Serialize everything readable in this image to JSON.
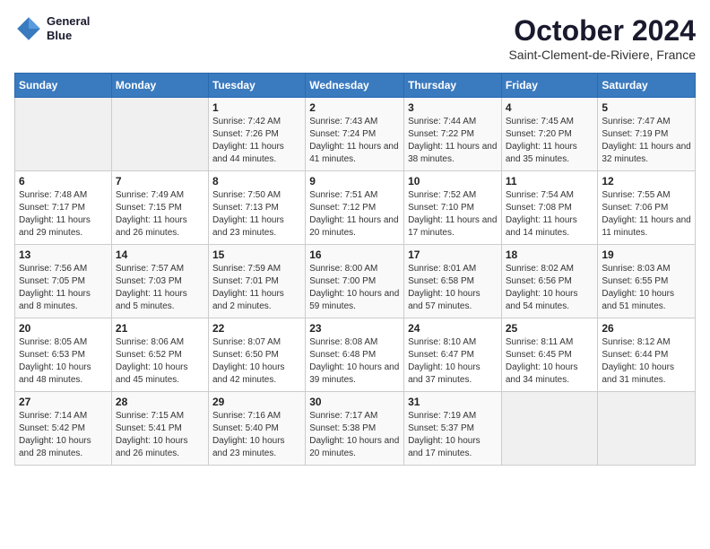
{
  "header": {
    "logo_line1": "General",
    "logo_line2": "Blue",
    "month": "October 2024",
    "location": "Saint-Clement-de-Riviere, France"
  },
  "weekdays": [
    "Sunday",
    "Monday",
    "Tuesday",
    "Wednesday",
    "Thursday",
    "Friday",
    "Saturday"
  ],
  "weeks": [
    [
      {
        "day": "",
        "detail": ""
      },
      {
        "day": "",
        "detail": ""
      },
      {
        "day": "1",
        "detail": "Sunrise: 7:42 AM\nSunset: 7:26 PM\nDaylight: 11 hours and 44 minutes."
      },
      {
        "day": "2",
        "detail": "Sunrise: 7:43 AM\nSunset: 7:24 PM\nDaylight: 11 hours and 41 minutes."
      },
      {
        "day": "3",
        "detail": "Sunrise: 7:44 AM\nSunset: 7:22 PM\nDaylight: 11 hours and 38 minutes."
      },
      {
        "day": "4",
        "detail": "Sunrise: 7:45 AM\nSunset: 7:20 PM\nDaylight: 11 hours and 35 minutes."
      },
      {
        "day": "5",
        "detail": "Sunrise: 7:47 AM\nSunset: 7:19 PM\nDaylight: 11 hours and 32 minutes."
      }
    ],
    [
      {
        "day": "6",
        "detail": "Sunrise: 7:48 AM\nSunset: 7:17 PM\nDaylight: 11 hours and 29 minutes."
      },
      {
        "day": "7",
        "detail": "Sunrise: 7:49 AM\nSunset: 7:15 PM\nDaylight: 11 hours and 26 minutes."
      },
      {
        "day": "8",
        "detail": "Sunrise: 7:50 AM\nSunset: 7:13 PM\nDaylight: 11 hours and 23 minutes."
      },
      {
        "day": "9",
        "detail": "Sunrise: 7:51 AM\nSunset: 7:12 PM\nDaylight: 11 hours and 20 minutes."
      },
      {
        "day": "10",
        "detail": "Sunrise: 7:52 AM\nSunset: 7:10 PM\nDaylight: 11 hours and 17 minutes."
      },
      {
        "day": "11",
        "detail": "Sunrise: 7:54 AM\nSunset: 7:08 PM\nDaylight: 11 hours and 14 minutes."
      },
      {
        "day": "12",
        "detail": "Sunrise: 7:55 AM\nSunset: 7:06 PM\nDaylight: 11 hours and 11 minutes."
      }
    ],
    [
      {
        "day": "13",
        "detail": "Sunrise: 7:56 AM\nSunset: 7:05 PM\nDaylight: 11 hours and 8 minutes."
      },
      {
        "day": "14",
        "detail": "Sunrise: 7:57 AM\nSunset: 7:03 PM\nDaylight: 11 hours and 5 minutes."
      },
      {
        "day": "15",
        "detail": "Sunrise: 7:59 AM\nSunset: 7:01 PM\nDaylight: 11 hours and 2 minutes."
      },
      {
        "day": "16",
        "detail": "Sunrise: 8:00 AM\nSunset: 7:00 PM\nDaylight: 10 hours and 59 minutes."
      },
      {
        "day": "17",
        "detail": "Sunrise: 8:01 AM\nSunset: 6:58 PM\nDaylight: 10 hours and 57 minutes."
      },
      {
        "day": "18",
        "detail": "Sunrise: 8:02 AM\nSunset: 6:56 PM\nDaylight: 10 hours and 54 minutes."
      },
      {
        "day": "19",
        "detail": "Sunrise: 8:03 AM\nSunset: 6:55 PM\nDaylight: 10 hours and 51 minutes."
      }
    ],
    [
      {
        "day": "20",
        "detail": "Sunrise: 8:05 AM\nSunset: 6:53 PM\nDaylight: 10 hours and 48 minutes."
      },
      {
        "day": "21",
        "detail": "Sunrise: 8:06 AM\nSunset: 6:52 PM\nDaylight: 10 hours and 45 minutes."
      },
      {
        "day": "22",
        "detail": "Sunrise: 8:07 AM\nSunset: 6:50 PM\nDaylight: 10 hours and 42 minutes."
      },
      {
        "day": "23",
        "detail": "Sunrise: 8:08 AM\nSunset: 6:48 PM\nDaylight: 10 hours and 39 minutes."
      },
      {
        "day": "24",
        "detail": "Sunrise: 8:10 AM\nSunset: 6:47 PM\nDaylight: 10 hours and 37 minutes."
      },
      {
        "day": "25",
        "detail": "Sunrise: 8:11 AM\nSunset: 6:45 PM\nDaylight: 10 hours and 34 minutes."
      },
      {
        "day": "26",
        "detail": "Sunrise: 8:12 AM\nSunset: 6:44 PM\nDaylight: 10 hours and 31 minutes."
      }
    ],
    [
      {
        "day": "27",
        "detail": "Sunrise: 7:14 AM\nSunset: 5:42 PM\nDaylight: 10 hours and 28 minutes."
      },
      {
        "day": "28",
        "detail": "Sunrise: 7:15 AM\nSunset: 5:41 PM\nDaylight: 10 hours and 26 minutes."
      },
      {
        "day": "29",
        "detail": "Sunrise: 7:16 AM\nSunset: 5:40 PM\nDaylight: 10 hours and 23 minutes."
      },
      {
        "day": "30",
        "detail": "Sunrise: 7:17 AM\nSunset: 5:38 PM\nDaylight: 10 hours and 20 minutes."
      },
      {
        "day": "31",
        "detail": "Sunrise: 7:19 AM\nSunset: 5:37 PM\nDaylight: 10 hours and 17 minutes."
      },
      {
        "day": "",
        "detail": ""
      },
      {
        "day": "",
        "detail": ""
      }
    ]
  ]
}
